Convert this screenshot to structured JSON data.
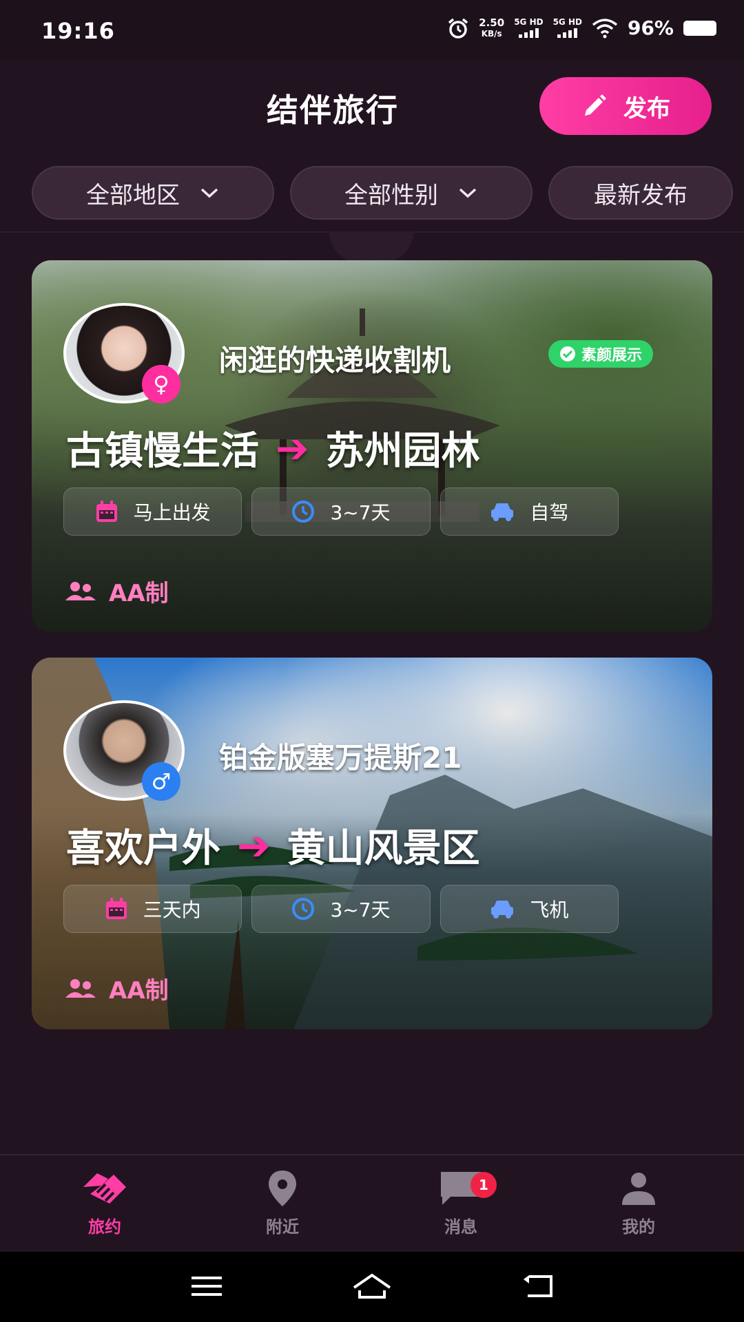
{
  "status": {
    "time": "19:16",
    "net_speed_top": "2.50",
    "net_speed_unit": "KB/s",
    "sim1": "5G HD",
    "sim2": "5G HD",
    "battery": "96%"
  },
  "header": {
    "title": "结伴旅行",
    "publish_label": "发布"
  },
  "filters": {
    "region": "全部地区",
    "gender": "全部性别",
    "sort": "最新发布"
  },
  "cards": [
    {
      "username": "闲逛的快递收割机",
      "gender_symbol": "♀",
      "badge": "素颜展示",
      "from": "古镇慢生活",
      "to": "苏州园林",
      "depart": "马上出发",
      "duration": "3~7天",
      "transport": "自驾",
      "cost": "AA制"
    },
    {
      "username": "铂金版塞万提斯21",
      "gender_symbol": "♂",
      "from": "喜欢户外",
      "to": "黄山风景区",
      "depart": "三天内",
      "duration": "3~7天",
      "transport": "飞机",
      "cost": "AA制"
    }
  ],
  "nav": {
    "items": [
      {
        "label": "旅约",
        "icon": "handshake-icon"
      },
      {
        "label": "附近",
        "icon": "location-pin-icon"
      },
      {
        "label": "消息",
        "icon": "chat-bubble-icon"
      },
      {
        "label": "我的",
        "icon": "person-icon"
      }
    ],
    "message_count": "1"
  },
  "colors": {
    "accent": "#ff3ea5",
    "background": "#221320",
    "badge_green": "#2fd36a"
  }
}
